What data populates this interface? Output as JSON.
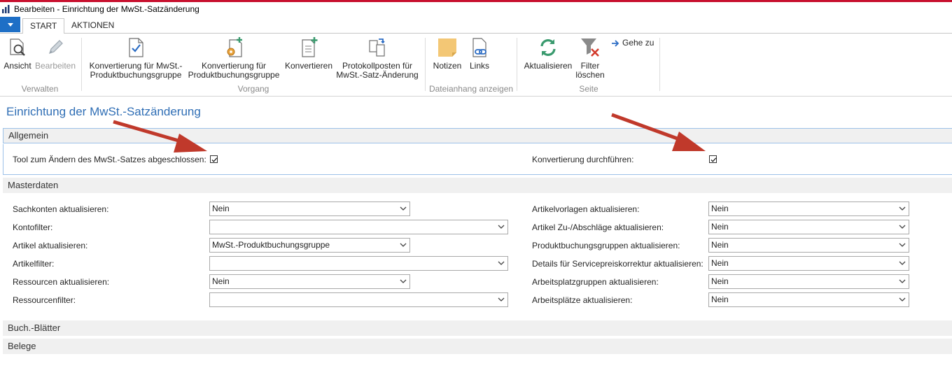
{
  "window": {
    "title": "Bearbeiten - Einrichtung der MwSt.-Satzänderung"
  },
  "tabs": [
    {
      "label": "START"
    },
    {
      "label": "AKTIONEN"
    }
  ],
  "ribbon": {
    "groups": [
      {
        "label": "Verwalten"
      },
      {
        "label": "Vorgang"
      },
      {
        "label": "Dateianhang anzeigen"
      },
      {
        "label": "Seite"
      }
    ],
    "buttons": {
      "ansicht": "Ansicht",
      "bearbeiten": "Bearbeiten",
      "konv_mwst_1": "Konvertierung für MwSt.-",
      "konv_mwst_2": "Produktbuchungsgruppe",
      "konv_prod_1": "Konvertierung für",
      "konv_prod_2": "Produktbuchungsgruppe",
      "konvertieren": "Konvertieren",
      "protokoll_1": "Protokollposten für",
      "protokoll_2": "MwSt.-Satz-Änderung",
      "notizen": "Notizen",
      "links": "Links",
      "aktualisieren": "Aktualisieren",
      "filter_1": "Filter",
      "filter_2": "löschen",
      "gehe_zu": "Gehe zu"
    }
  },
  "page": {
    "title": "Einrichtung der MwSt.-Satzänderung",
    "sections": {
      "allgemein": "Allgemein",
      "masterdaten": "Masterdaten",
      "buch_blaetter": "Buch.-Blätter",
      "belege": "Belege"
    }
  },
  "allgemein": {
    "tool_label": "Tool zum Ändern des MwSt.-Satzes abgeschlossen:",
    "tool_checked": true,
    "konv_label": "Konvertierung durchführen:",
    "konv_checked": true
  },
  "masterdaten": {
    "left": [
      {
        "label": "Sachkonten aktualisieren:",
        "value": "Nein"
      },
      {
        "label": "Kontofilter:",
        "value": ""
      },
      {
        "label": "Artikel aktualisieren:",
        "value": "MwSt.-Produktbuchungsgruppe"
      },
      {
        "label": "Artikelfilter:",
        "value": ""
      },
      {
        "label": "Ressourcen aktualisieren:",
        "value": "Nein"
      },
      {
        "label": "Ressourcenfilter:",
        "value": ""
      }
    ],
    "right": [
      {
        "label": "Artikelvorlagen aktualisieren:",
        "value": "Nein"
      },
      {
        "label": "Artikel Zu-/Abschläge aktualisieren:",
        "value": "Nein"
      },
      {
        "label": "Produktbuchungsgruppen aktualisieren:",
        "value": "Nein"
      },
      {
        "label": "Details für Servicepreiskorrektur aktualisieren:",
        "value": "Nein"
      },
      {
        "label": "Arbeitsplatzgruppen aktualisieren:",
        "value": "Nein"
      },
      {
        "label": "Arbeitsplätze aktualisieren:",
        "value": "Nein"
      }
    ]
  },
  "colors": {
    "accent": "#2f6eb5",
    "menu_blue": "#1e6fc6",
    "annotation_arrow": "#c0392b",
    "top_line": "#c8102e"
  }
}
